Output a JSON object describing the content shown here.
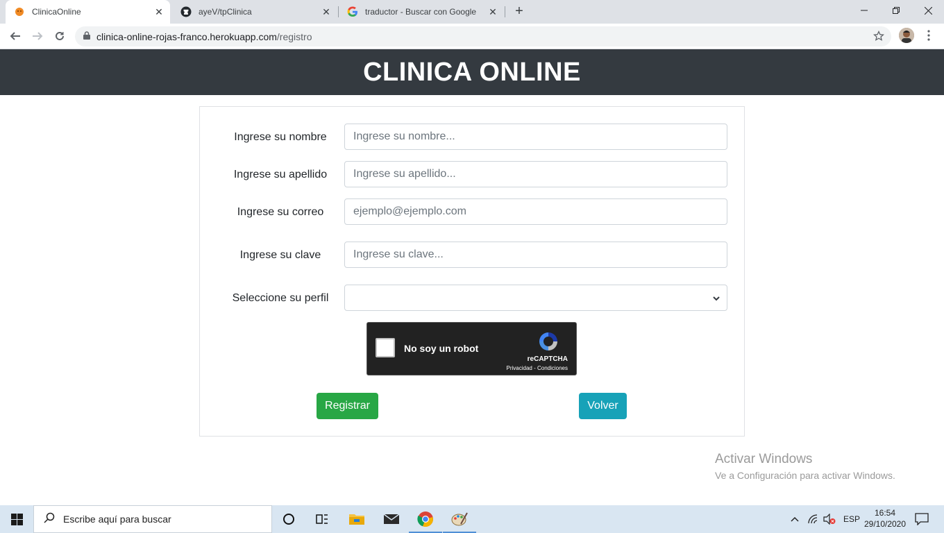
{
  "browser": {
    "tabs": [
      {
        "title": "ClinicaOnline",
        "active": true
      },
      {
        "title": "ayeV/tpClinica",
        "active": false
      },
      {
        "title": "traductor - Buscar con Google",
        "active": false
      }
    ],
    "url_host": "clinica-online-rojas-franco.herokuapp.com",
    "url_path": "/registro"
  },
  "page": {
    "header_title": "CLINICA ONLINE"
  },
  "form": {
    "fields": [
      {
        "label": "Ingrese su nombre",
        "placeholder": "Ingrese su nombre..."
      },
      {
        "label": "Ingrese su apellido",
        "placeholder": "Ingrese su apellido..."
      },
      {
        "label": "Ingrese su correo",
        "placeholder": "ejemplo@ejemplo.com"
      },
      {
        "label": "Ingrese su clave",
        "placeholder": "Ingrese su clave..."
      }
    ],
    "profile_label": "Seleccione su perfil",
    "profile_value": "",
    "captcha": {
      "text": "No soy un robot",
      "brand": "reCAPTCHA",
      "links": "Privacidad - Condiciones"
    },
    "register_label": "Registrar",
    "back_label": "Volver"
  },
  "watermark": {
    "line1": "Activar Windows",
    "line2": "Ve a Configuración para activar Windows."
  },
  "taskbar": {
    "search_placeholder": "Escribe aquí para buscar",
    "language": "ESP",
    "time": "16:54",
    "date": "29/10/2020"
  }
}
